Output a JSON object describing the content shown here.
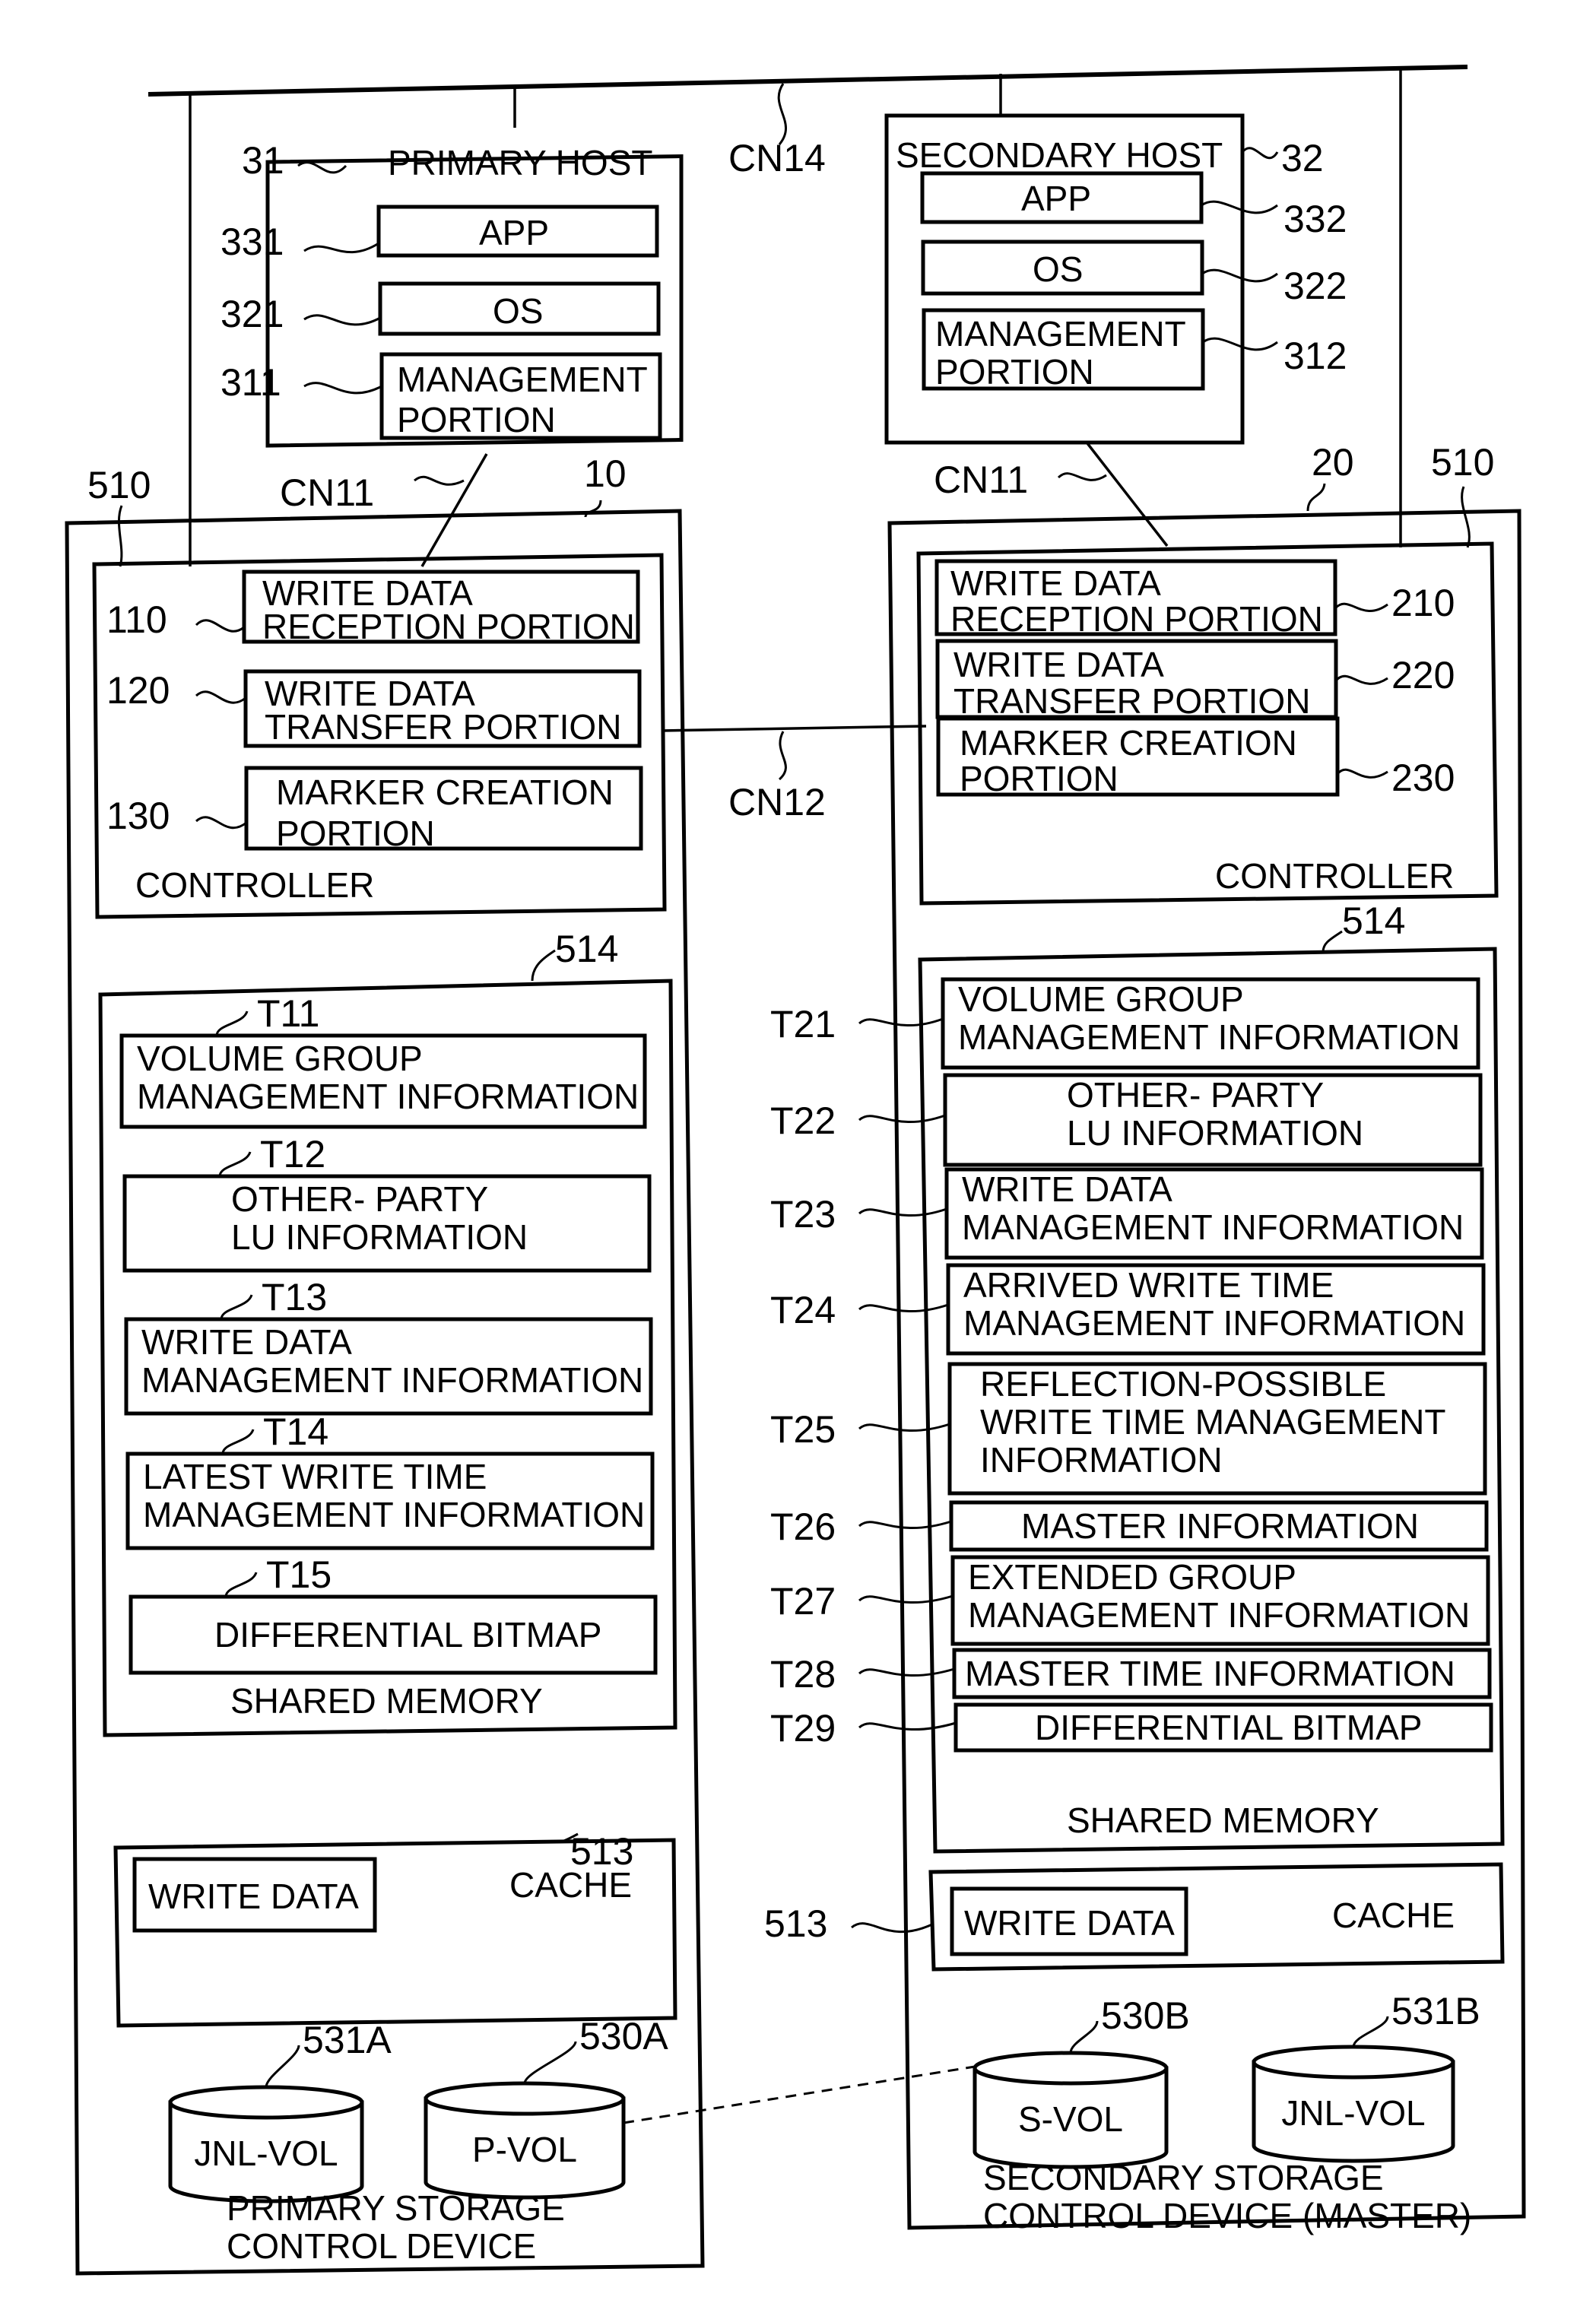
{
  "network": {
    "cn14": "CN14",
    "cn11_left": "CN11",
    "cn11_right": "CN11",
    "cn12": "CN12"
  },
  "primary_host": {
    "ref": "31",
    "title": "PRIMARY HOST",
    "components": [
      {
        "ref": "331",
        "lines": [
          "APP"
        ]
      },
      {
        "ref": "321",
        "lines": [
          "OS"
        ]
      },
      {
        "ref": "311",
        "lines": [
          "MANAGEMENT",
          "PORTION"
        ]
      }
    ]
  },
  "secondary_host": {
    "ref": "32",
    "title": "SECONDARY HOST",
    "components": [
      {
        "ref": "332",
        "lines": [
          "APP"
        ]
      },
      {
        "ref": "322",
        "lines": [
          "OS"
        ]
      },
      {
        "ref": "312",
        "lines": [
          "MANAGEMENT",
          "PORTION"
        ]
      }
    ]
  },
  "primary_storage": {
    "ref": "10",
    "ref_510": "510",
    "title_lines": [
      "PRIMARY STORAGE",
      "CONTROL DEVICE"
    ],
    "controller": {
      "label": "CONTROLLER",
      "portions": [
        {
          "ref": "110",
          "lines": [
            "WRITE DATA",
            "RECEPTION PORTION"
          ]
        },
        {
          "ref": "120",
          "lines": [
            "WRITE DATA",
            "TRANSFER PORTION"
          ]
        },
        {
          "ref": "130",
          "lines": [
            "MARKER CREATION",
            "PORTION"
          ]
        }
      ]
    },
    "shared_memory": {
      "ref": "514",
      "label": "SHARED MEMORY",
      "tables": [
        {
          "ref": "T11",
          "lines": [
            "VOLUME GROUP",
            "MANAGEMENT INFORMATION"
          ]
        },
        {
          "ref": "T12",
          "lines": [
            "OTHER- PARTY",
            "LU INFORMATION"
          ]
        },
        {
          "ref": "T13",
          "lines": [
            "WRITE DATA",
            "MANAGEMENT INFORMATION"
          ]
        },
        {
          "ref": "T14",
          "lines": [
            "LATEST WRITE TIME",
            "MANAGEMENT INFORMATION"
          ]
        },
        {
          "ref": "T15",
          "lines": [
            "DIFFERENTIAL BITMAP"
          ]
        }
      ]
    },
    "cache": {
      "ref": "513",
      "label": "CACHE",
      "item": "WRITE DATA"
    },
    "volumes": [
      {
        "ref": "531A",
        "label": "JNL-VOL"
      },
      {
        "ref": "530A",
        "label": "P-VOL"
      }
    ]
  },
  "secondary_storage": {
    "ref": "20",
    "ref_510": "510",
    "title_lines": [
      "SECONDARY STORAGE",
      "CONTROL DEVICE (MASTER)"
    ],
    "controller": {
      "label": "CONTROLLER",
      "portions": [
        {
          "ref": "210",
          "lines": [
            "WRITE DATA",
            "RECEPTION PORTION"
          ]
        },
        {
          "ref": "220",
          "lines": [
            "WRITE DATA",
            "TRANSFER PORTION"
          ]
        },
        {
          "ref": "230",
          "lines": [
            "MARKER CREATION",
            "PORTION"
          ]
        }
      ]
    },
    "shared_memory": {
      "ref": "514",
      "label": "SHARED MEMORY",
      "tables": [
        {
          "ref": "T21",
          "lines": [
            "VOLUME GROUP",
            "MANAGEMENT INFORMATION"
          ]
        },
        {
          "ref": "T22",
          "lines": [
            "OTHER- PARTY",
            "LU INFORMATION"
          ]
        },
        {
          "ref": "T23",
          "lines": [
            "WRITE DATA",
            "MANAGEMENT INFORMATION"
          ]
        },
        {
          "ref": "T24",
          "lines": [
            "ARRIVED WRITE TIME",
            "MANAGEMENT INFORMATION"
          ]
        },
        {
          "ref": "T25",
          "lines": [
            "REFLECTION-POSSIBLE",
            "WRITE TIME MANAGEMENT",
            "INFORMATION"
          ]
        },
        {
          "ref": "T26",
          "lines": [
            "MASTER INFORMATION"
          ]
        },
        {
          "ref": "T27",
          "lines": [
            "EXTENDED GROUP",
            "MANAGEMENT INFORMATION"
          ]
        },
        {
          "ref": "T28",
          "lines": [
            "MASTER TIME INFORMATION"
          ]
        },
        {
          "ref": "T29",
          "lines": [
            "DIFFERENTIAL BITMAP"
          ]
        }
      ]
    },
    "cache": {
      "ref": "513",
      "label": "CACHE",
      "item": "WRITE DATA"
    },
    "volumes": [
      {
        "ref": "530B",
        "label": "S-VOL"
      },
      {
        "ref": "531B",
        "label": "JNL-VOL"
      }
    ]
  }
}
